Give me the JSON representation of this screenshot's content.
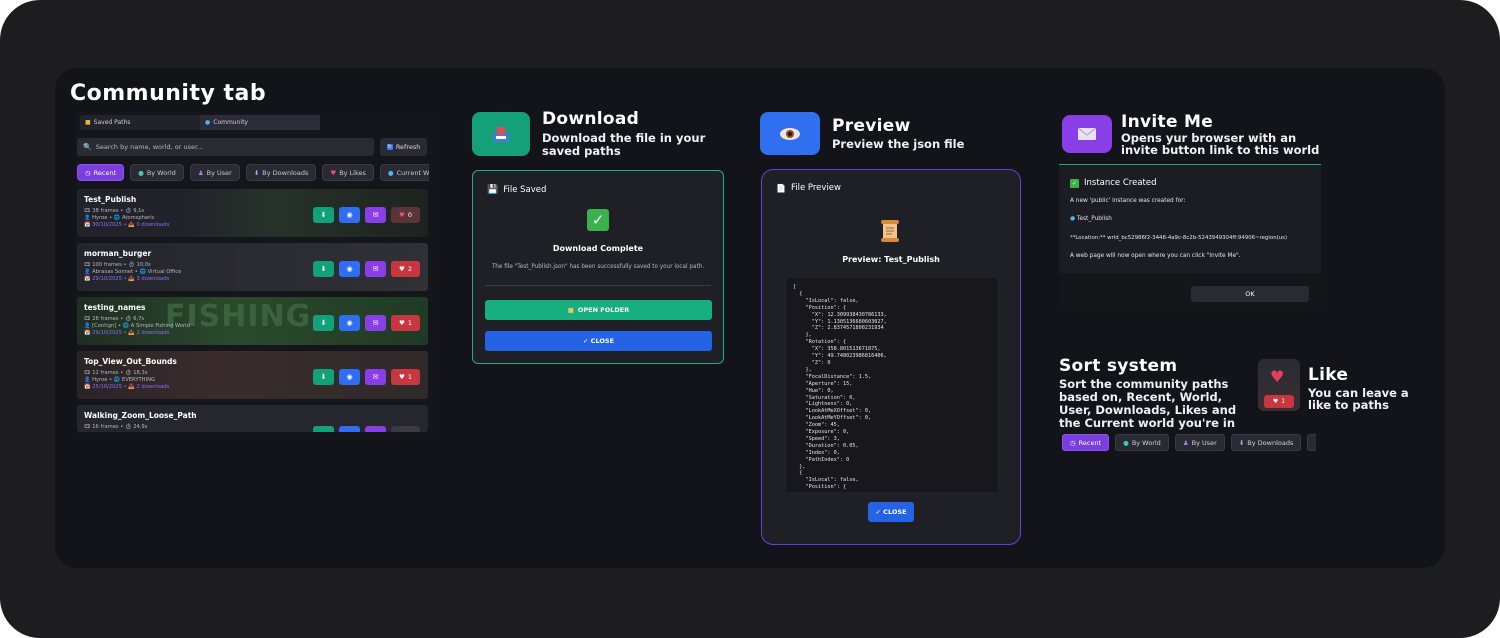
{
  "colors": {
    "accent_purple": "#7b3fe0",
    "green": "#12a27a",
    "blue": "#2f6df2",
    "red": "#c8373f"
  },
  "community": {
    "title": "Community tab",
    "tabs": [
      {
        "label": "Saved Paths",
        "icon": "folder-icon"
      },
      {
        "label": "Community",
        "icon": "globe-icon"
      }
    ],
    "search_placeholder": "Search by name, world, or user...",
    "refresh_label": "Refresh",
    "filters": [
      "Recent",
      "By World",
      "By User",
      "By Downloads",
      "By Likes",
      "Current World"
    ],
    "cards": [
      {
        "title": "Test_Publish",
        "frames": "38 frames",
        "duration": "9,1s",
        "user": "Hyroe",
        "world": "Atomspheric",
        "date": "30/10/2025",
        "downloads": "0 downloads",
        "likes": "0"
      },
      {
        "title": "morman_burger",
        "frames": "100 frames",
        "duration": "10,0s",
        "user": "Abraxas Sonnet",
        "world": "Virtual Office",
        "date": "29/10/2025",
        "downloads": "3 downloads",
        "likes": "2"
      },
      {
        "title": "testing_names",
        "frames": "28 frames",
        "duration": "6,7s",
        "user": "[Contign]",
        "world": "A Simple Fishing World",
        "date": "29/10/2025",
        "downloads": "2 downloads",
        "likes": "1"
      },
      {
        "title": "Top_View_Out_Bounds",
        "frames": "12 frames",
        "duration": "18,3s",
        "user": "Hyroe",
        "world": "EVERYTHING",
        "date": "25/10/2025",
        "downloads": "2 downloads",
        "likes": "1"
      },
      {
        "title": "Walking_Zoom_Loose_Path",
        "frames": "16 frames",
        "duration": "24,9s"
      }
    ],
    "background_text": "FISHING"
  },
  "download": {
    "title": "Download",
    "subtitle_line1": "Download the file in your",
    "subtitle_line2": "saved paths",
    "dialog_title": "File Saved",
    "heading": "Download Complete",
    "message": "The file \"Test_Publish.json\" has been successfully saved to your local path.",
    "open_folder": "OPEN FOLDER",
    "close": "✓ CLOSE"
  },
  "preview": {
    "title": "Preview",
    "subtitle": "Preview the json file",
    "dialog_title": "File Preview",
    "heading": "Preview: Test_Publish",
    "close": "✓ CLOSE",
    "json_text": "[\n  {\n    \"IsLocal\": false,\n    \"Position\": {\n      \"X\": 12.309938430786133,\n      \"Y\": 1.1305136680603027,\n      \"Z\": 2.8374571800231934\n    },\n    \"Rotation\": {\n      \"X\": 358.801513671875,\n      \"Y\": 49.748023986816406,\n      \"Z\": 0\n    },\n    \"FocalDistance\": 1.5,\n    \"Aperture\": 15,\n    \"Hue\": 0,\n    \"Saturation\": 0,\n    \"Lightness\": 0,\n    \"LookAtMeXOffset\": 0,\n    \"LookAtMeYOffset\": 0,\n    \"Zoom\": 45,\n    \"Exposure\": 0,\n    \"Speed\": 3,\n    \"Duration\": 0.05,\n    \"Index\": 0,\n    \"PathIndex\": 0\n  },\n  {\n    \"IsLocal\": false,\n    \"Position\": {"
  },
  "invite": {
    "title": "Invite Me",
    "subtitle_line1": "Opens yur browser with an",
    "subtitle_line2": "invite button link to this world",
    "dialog_title": "Instance Created",
    "line1": "A new 'public' instance was created for:",
    "world": "Test_Publish",
    "location": "**Location:** wrld_bc52986f2-3448-4a9c-8c2b-5243949304ff:94906~region(us)",
    "line3": "A web page will now open where you can click \"Invite Me\".",
    "ok": "OK"
  },
  "sort": {
    "title": "Sort system",
    "desc": [
      "Sort the community paths",
      "based on, Recent, World,",
      "User, Downloads, Likes and",
      "the Current world you're in"
    ],
    "buttons": [
      "Recent",
      "By World",
      "By User",
      "By Downloads"
    ]
  },
  "like": {
    "title": "Like",
    "desc": [
      "You can leave a",
      "like to paths"
    ],
    "count": "1"
  }
}
